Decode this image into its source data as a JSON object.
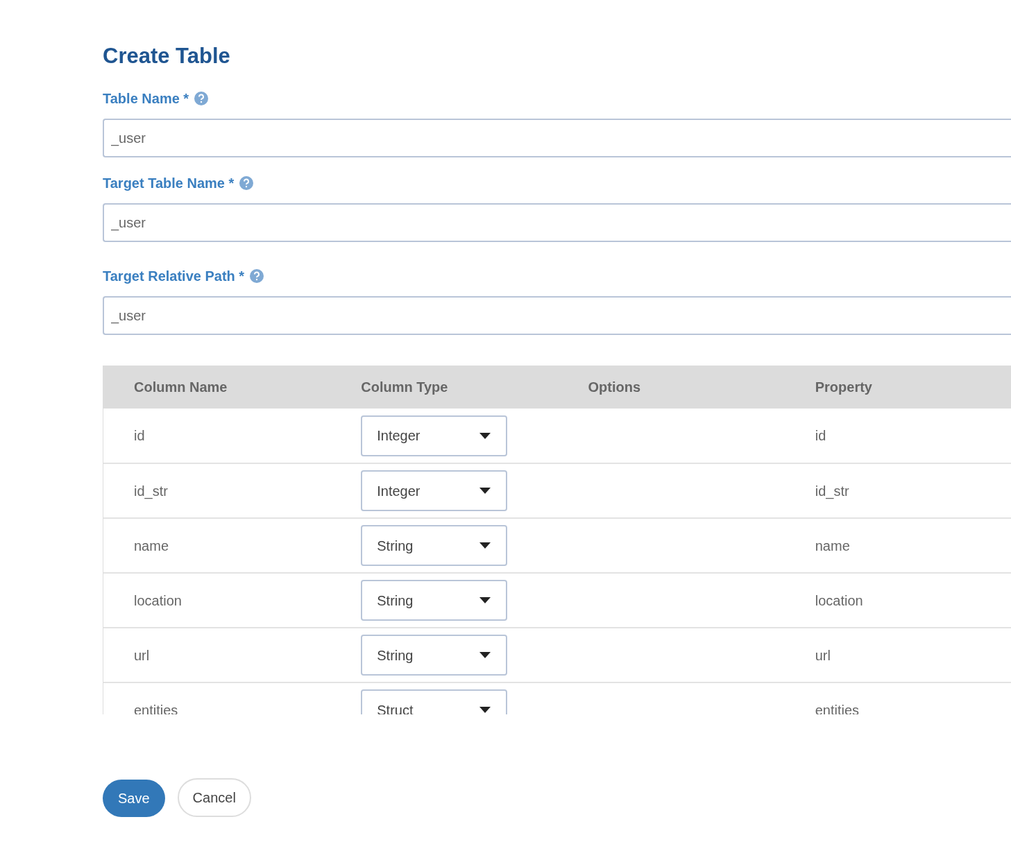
{
  "title": "Create Table",
  "fields": [
    {
      "label": "Table Name *",
      "value": "_user"
    },
    {
      "label": "Target Table Name *",
      "value": "_user"
    },
    {
      "label": "Target Relative Path *",
      "value": "_user"
    }
  ],
  "table": {
    "columns": [
      "Column Name",
      "Column Type",
      "Options",
      "Property"
    ],
    "rows": [
      {
        "name": "id",
        "type": "Integer",
        "property": "id"
      },
      {
        "name": "id_str",
        "type": "Integer",
        "property": "id_str"
      },
      {
        "name": "name",
        "type": "String",
        "property": "name"
      },
      {
        "name": "location",
        "type": "String",
        "property": "location"
      },
      {
        "name": "url",
        "type": "String",
        "property": "url"
      },
      {
        "name": "entities",
        "type": "Struct",
        "property": "entities"
      }
    ]
  },
  "buttons": [
    {
      "label": "Save",
      "kind": "primary"
    },
    {
      "label": "Cancel",
      "kind": "secondary"
    }
  ]
}
